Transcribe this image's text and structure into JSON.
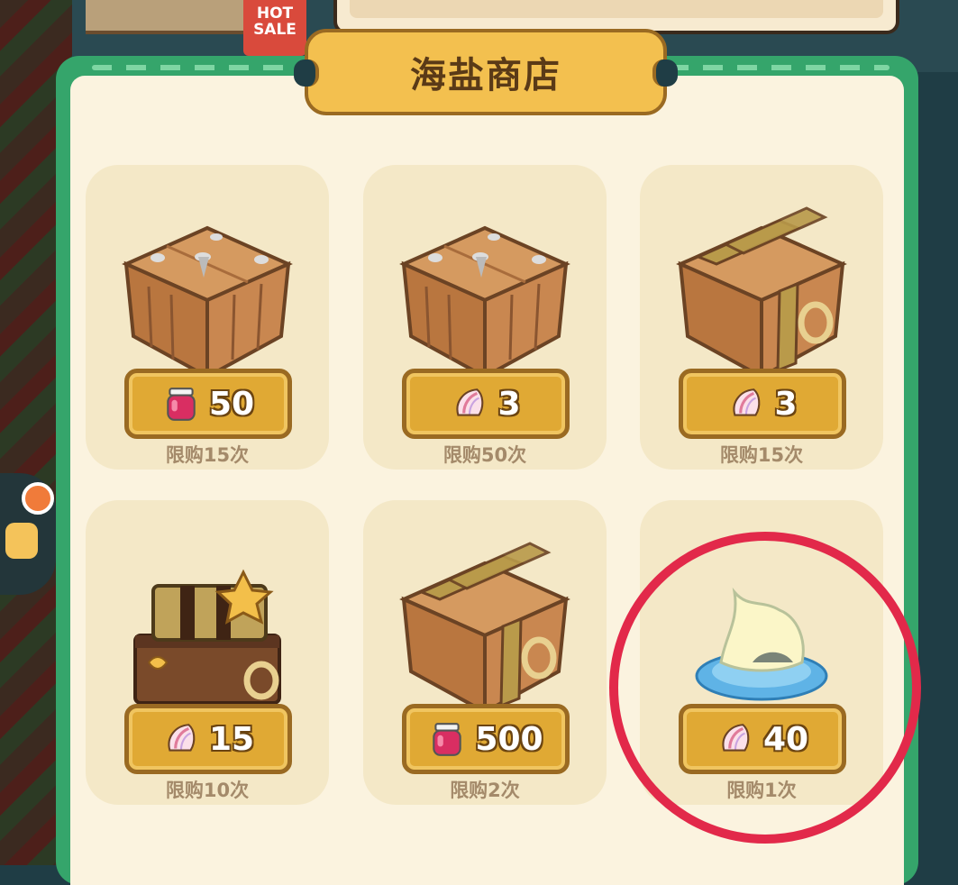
{
  "hot_tag": "HOT SALE",
  "shop_title": "海盐商店",
  "items": [
    {
      "name": "wooden-crate",
      "price": "50",
      "currency": "jam-jar",
      "limit": "限购15次"
    },
    {
      "name": "wooden-crate",
      "price": "3",
      "currency": "shell",
      "limit": "限购50次"
    },
    {
      "name": "strapped-crate",
      "price": "3",
      "currency": "shell",
      "limit": "限购15次"
    },
    {
      "name": "treasure-chest-stack",
      "price": "15",
      "currency": "shell",
      "limit": "限购10次"
    },
    {
      "name": "strapped-crate",
      "price": "500",
      "currency": "jam-jar",
      "limit": "限购2次"
    },
    {
      "name": "sea-salt-puddle",
      "price": "40",
      "currency": "shell",
      "limit": "限购1次"
    }
  ],
  "colors": {
    "panel_green": "#35a56b",
    "highlight_circle": "#e2294a",
    "price_gold": "#e0a934"
  }
}
